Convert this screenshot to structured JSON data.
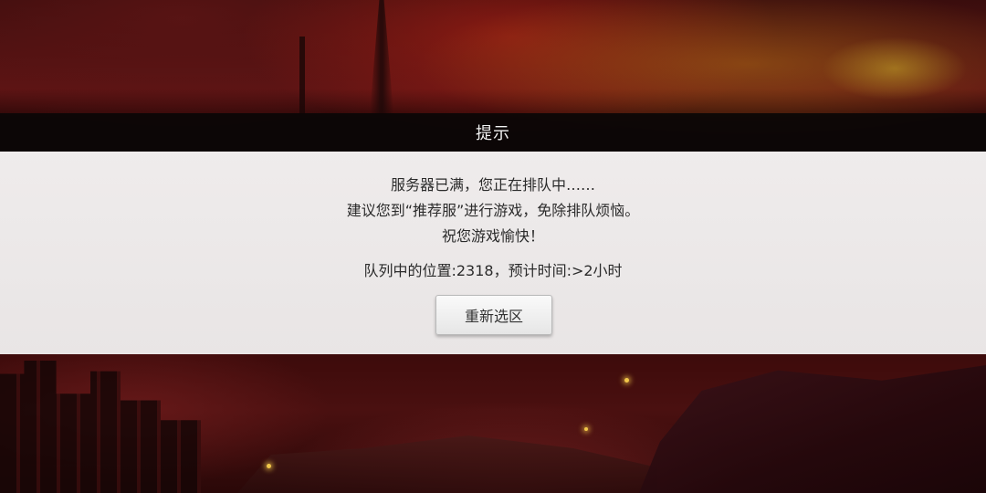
{
  "dialog": {
    "title": "提示",
    "message_lines": [
      "服务器已满，您正在排队中……",
      "建议您到“推荐服”进行游戏，免除排队烦恼。",
      "祝您游戏愉快！"
    ],
    "queue_info": "队列中的位置:2318，预计时间:>2小时",
    "reselect_button_label": "重新选区"
  },
  "colors": {
    "header_bg": "#0a0606",
    "body_bg": "#f3f1f1",
    "text": "#2b2b2b",
    "background_tint": "#5e1414"
  }
}
